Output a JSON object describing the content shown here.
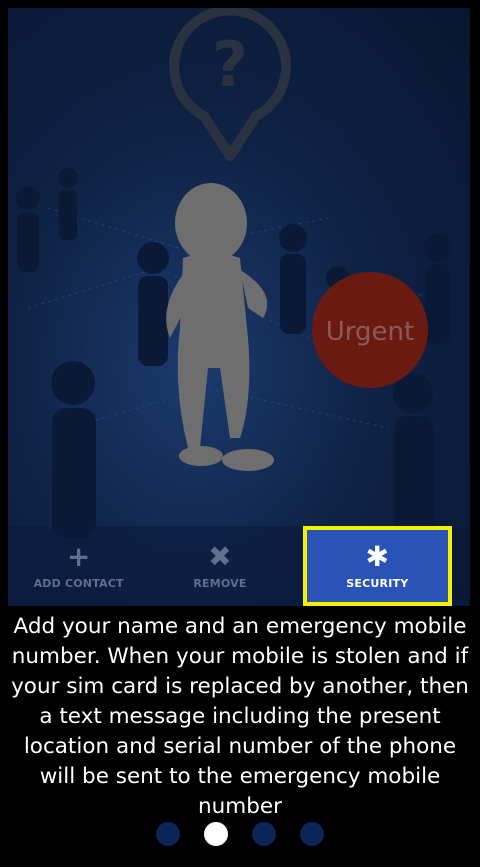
{
  "hero": {
    "badge_text": "Urgent",
    "question_mark": "?"
  },
  "toolbar": {
    "items": [
      {
        "label": "ADD CONTACT",
        "icon": "plus-icon",
        "glyph": "+"
      },
      {
        "label": "REMOVE",
        "icon": "close-icon",
        "glyph": "✖"
      },
      {
        "label": "SECURITY",
        "icon": "gear-icon",
        "glyph": "✱"
      }
    ],
    "active_index": 2
  },
  "description": "Add your name and an emergency mobile number. When your mobile is stolen and if your sim card is replaced by another, then a text message including the present location and serial number of the phone will be sent to the emergency mobile number",
  "pager": {
    "pages": 4,
    "current_index": 1
  },
  "colors": {
    "highlight_border": "#f5f000",
    "active_bg": "#2a53b8",
    "badge": "#6b1a12"
  }
}
